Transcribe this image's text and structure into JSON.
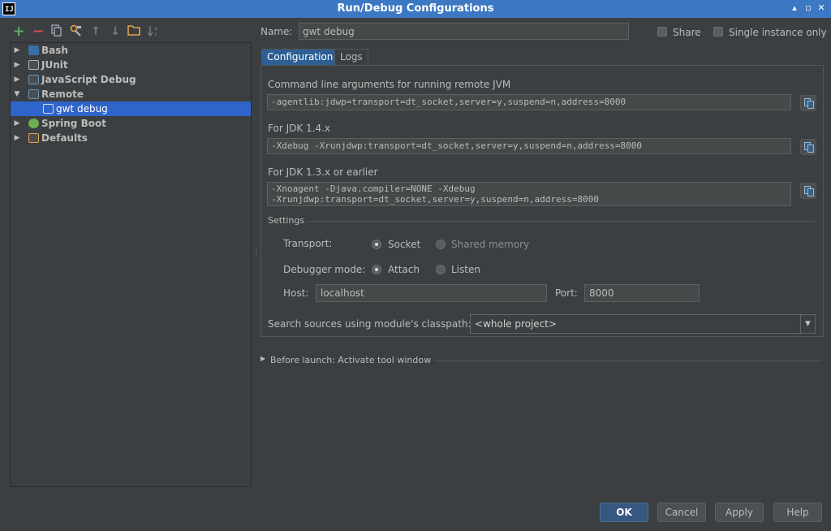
{
  "window": {
    "title": "Run/Debug Configurations",
    "app_icon": "IJ"
  },
  "toolbar": {
    "icons": [
      "add-icon",
      "remove-icon",
      "copy-icon",
      "edit-defaults-icon",
      "move-up-icon",
      "move-down-icon",
      "folder-icon",
      "sort-icon"
    ],
    "glyphs": {
      "add": "+",
      "remove": "−",
      "up": "↑",
      "down": "↓"
    }
  },
  "tree": {
    "items": [
      {
        "label": "Bash",
        "icon": "bash-icon",
        "expanded": false
      },
      {
        "label": "JUnit",
        "icon": "junit-icon",
        "expanded": false
      },
      {
        "label": "JavaScript Debug",
        "icon": "javascript-debug-icon",
        "expanded": false
      },
      {
        "label": "Remote",
        "icon": "remote-icon",
        "expanded": true
      },
      {
        "label": "gwt debug",
        "icon": "remote-config-icon",
        "selected": true
      },
      {
        "label": "Spring Boot",
        "icon": "spring-boot-icon",
        "expanded": false
      },
      {
        "label": "Defaults",
        "icon": "defaults-icon",
        "expanded": false
      }
    ]
  },
  "name_field": {
    "label": "Name:",
    "value": "gwt debug"
  },
  "share": {
    "label": "Share",
    "checked": false
  },
  "single_instance": {
    "label": "Single instance only",
    "checked": false
  },
  "tabs": [
    {
      "label": "Configuration",
      "active": true
    },
    {
      "label": "Logs",
      "active": false
    }
  ],
  "config": {
    "cmd_label": "Command line arguments for running remote JVM",
    "cmd_value": "-agentlib:jdwp=transport=dt_socket,server=y,suspend=n,address=8000",
    "jdk14_label": "For JDK 1.4.x",
    "jdk14_value": "-Xdebug -Xrunjdwp:transport=dt_socket,server=y,suspend=n,address=8000",
    "jdk13_label": "For JDK 1.3.x or earlier",
    "jdk13_value_line1": "-Xnoagent -Djava.compiler=NONE -Xdebug",
    "jdk13_value_line2": "-Xrunjdwp:transport=dt_socket,server=y,suspend=n,address=8000"
  },
  "settings": {
    "section_label": "Settings",
    "transport_label": "Transport:",
    "transport_options": [
      "Socket",
      "Shared memory"
    ],
    "transport_selected": "Socket",
    "debugger_mode_label": "Debugger mode:",
    "debugger_mode_options": [
      "Attach",
      "Listen"
    ],
    "debugger_mode_selected": "Attach",
    "host_label": "Host:",
    "host_value": "localhost",
    "port_label": "Port:",
    "port_value": "8000",
    "classpath_label": "Search sources using module's classpath:",
    "classpath_value": "<whole project>"
  },
  "before_launch": {
    "label": "Before launch: Activate tool window"
  },
  "buttons": {
    "ok": "OK",
    "cancel": "Cancel",
    "apply": "Apply",
    "help": "Help"
  },
  "colors": {
    "selection": "#2f65ca",
    "titlebar": "#3c78c3",
    "background": "#3c3f41",
    "add": "#59a869",
    "remove": "#c75450"
  }
}
